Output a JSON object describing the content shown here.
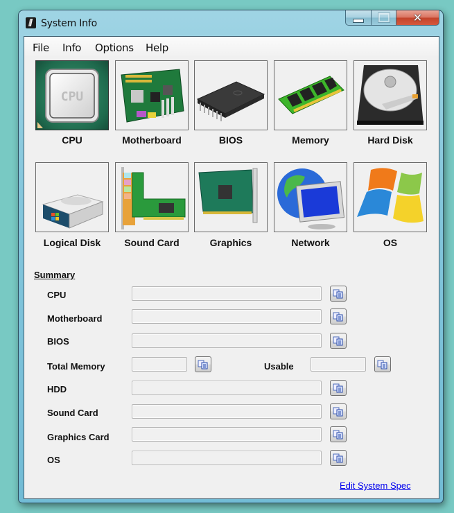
{
  "window": {
    "title": "System Info",
    "icon": "app-icon",
    "controls": {
      "minimize": "minimize-icon",
      "maximize": "maximize-icon",
      "close": "✕"
    }
  },
  "menu": [
    {
      "label": "File"
    },
    {
      "label": "Info"
    },
    {
      "label": "Options"
    },
    {
      "label": "Help"
    }
  ],
  "tiles": [
    {
      "label": "CPU",
      "icon": "cpu-icon",
      "selected": true
    },
    {
      "label": "Motherboard",
      "icon": "motherboard-icon"
    },
    {
      "label": "BIOS",
      "icon": "bios-chip-icon"
    },
    {
      "label": "Memory",
      "icon": "memory-icon"
    },
    {
      "label": "Hard Disk",
      "icon": "hard-disk-icon"
    },
    {
      "label": "Logical Disk",
      "icon": "logical-disk-icon"
    },
    {
      "label": "Sound Card",
      "icon": "sound-card-icon"
    },
    {
      "label": "Graphics",
      "icon": "graphics-card-icon"
    },
    {
      "label": "Network",
      "icon": "network-icon"
    },
    {
      "label": "OS",
      "icon": "windows-logo-icon"
    }
  ],
  "summary": {
    "title": "Summary",
    "fields": [
      {
        "label": "CPU",
        "value": ""
      },
      {
        "label": "Motherboard",
        "value": ""
      },
      {
        "label": "BIOS",
        "value": ""
      },
      {
        "label": "Total Memory",
        "value": ""
      },
      {
        "label": "HDD",
        "value": ""
      },
      {
        "label": "Sound Card",
        "value": ""
      },
      {
        "label": "Graphics Card",
        "value": ""
      },
      {
        "label": "OS",
        "value": ""
      }
    ],
    "usable": {
      "label": "Usable",
      "value": ""
    },
    "copy_icon": "copy-icon"
  },
  "link": {
    "label": "Edit System Spec"
  }
}
